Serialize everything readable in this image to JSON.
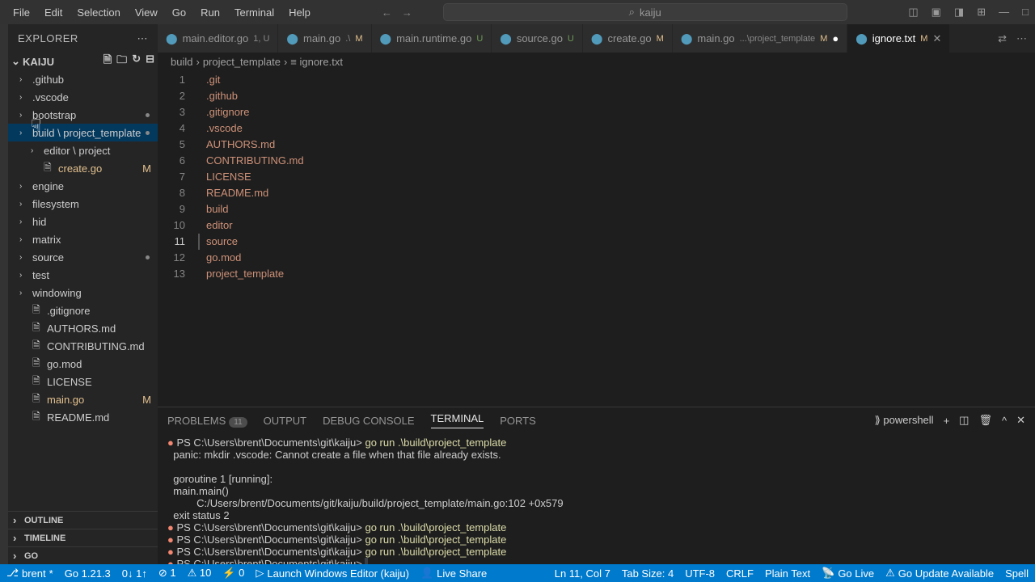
{
  "menu": [
    "File",
    "Edit",
    "Selection",
    "View",
    "Go",
    "Run",
    "Terminal",
    "Help"
  ],
  "search_placeholder": "kaiju",
  "explorer_label": "Explorer",
  "project_name": "Kaiju",
  "tree": [
    {
      "label": ".github",
      "type": "folder"
    },
    {
      "label": ".vscode",
      "type": "folder"
    },
    {
      "label": "bootstrap",
      "type": "folder",
      "dot": true
    },
    {
      "label": "build \\ project_template",
      "type": "folder",
      "selected": true,
      "dot": true
    },
    {
      "label": "editor \\ project",
      "type": "folder",
      "indent": true
    },
    {
      "label": "create.go",
      "type": "file",
      "indent": true,
      "badge": "M",
      "color": "mod"
    },
    {
      "label": "engine",
      "type": "folder"
    },
    {
      "label": "filesystem",
      "type": "folder"
    },
    {
      "label": "hid",
      "type": "folder"
    },
    {
      "label": "matrix",
      "type": "folder"
    },
    {
      "label": "source",
      "type": "folder",
      "dot": true
    },
    {
      "label": "test",
      "type": "folder"
    },
    {
      "label": "windowing",
      "type": "folder"
    },
    {
      "label": ".gitignore",
      "type": "file"
    },
    {
      "label": "AUTHORS.md",
      "type": "file"
    },
    {
      "label": "CONTRIBUTING.md",
      "type": "file"
    },
    {
      "label": "go.mod",
      "type": "file"
    },
    {
      "label": "LICENSE",
      "type": "file"
    },
    {
      "label": "main.go",
      "type": "file",
      "badge": "M",
      "color": "mod"
    },
    {
      "label": "README.md",
      "type": "file"
    }
  ],
  "sections": [
    "Outline",
    "Timeline",
    "Go"
  ],
  "tabs": [
    {
      "label": "main.editor.go",
      "suffix": "1, U",
      "status": "u"
    },
    {
      "label": "main.go",
      "suffix": ".\\",
      "status": "m",
      "badge": "M"
    },
    {
      "label": "main.runtime.go",
      "status": "u",
      "badge": "U"
    },
    {
      "label": "source.go",
      "status": "u",
      "badge": "U"
    },
    {
      "label": "create.go",
      "status": "m",
      "badge": "M"
    },
    {
      "label": "main.go",
      "suffix": "...\\project_template",
      "status": "m",
      "badge": "M",
      "dot": true
    },
    {
      "label": "ignore.txt",
      "status": "m",
      "badge": "M",
      "active": true
    }
  ],
  "breadcrumb": [
    "build",
    "project_template",
    "ignore.txt"
  ],
  "lines": [
    ".git",
    ".github",
    ".gitignore",
    ".vscode",
    "AUTHORS.md",
    "CONTRIBUTING.md",
    "LICENSE",
    "README.md",
    "build",
    "editor",
    "source",
    "go.mod",
    "project_template"
  ],
  "active_line": 11,
  "panel_tabs": [
    {
      "label": "PROBLEMS",
      "count": "11"
    },
    {
      "label": "OUTPUT"
    },
    {
      "label": "DEBUG CONSOLE"
    },
    {
      "label": "TERMINAL",
      "active": true
    },
    {
      "label": "PORTS"
    }
  ],
  "shell_name": "powershell",
  "terminal": {
    "prompt": "PS C:\\Users\\brent\\Documents\\git\\kaiju>",
    "cmd": "go run .\\build\\project_template",
    "panic": "panic: mkdir .vscode: Cannot create a file when that file already exists.",
    "goroutine": "goroutine 1 [running]:",
    "mainmain": "main.main()",
    "trace": "C:/Users/brent/Documents/git/kaiju/build/project_template/main.go:102 +0x579",
    "exit": "exit status 2"
  },
  "status": {
    "branch": "brent",
    "go": "Go 1.21.3",
    "sync": "0↓ 1↑",
    "errors": "⊘ 1",
    "warnings": "⚠ 10",
    "port": "⚡ 0",
    "launch": "Launch Windows Editor (kaiju)",
    "live": "Live Share",
    "pos": "Ln 11, Col 7",
    "tab": "Tab Size: 4",
    "enc": "UTF-8",
    "eol": "CRLF",
    "lang": "Plain Text",
    "golive": "Go Live",
    "update": "Go Update Available",
    "spell": "Spell"
  }
}
